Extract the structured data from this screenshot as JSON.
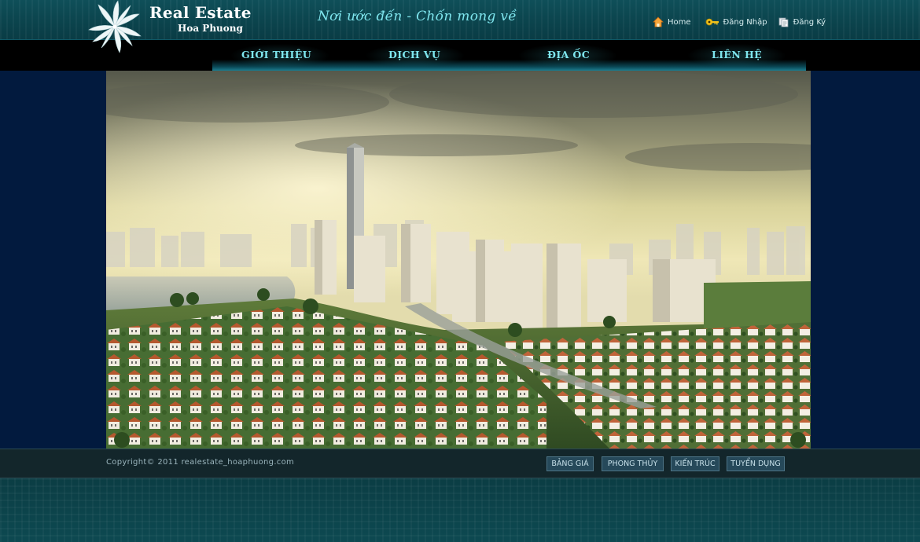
{
  "header": {
    "logo_title": "Real Estate",
    "logo_subtitle": "Hoa Phuong",
    "slogan": "Nơi ước đến - Chốn mong về",
    "links": [
      {
        "label": "Home",
        "icon": "home-icon"
      },
      {
        "label": "Đăng Nhập",
        "icon": "key-icon"
      },
      {
        "label": "Đăng Ký",
        "icon": "register-icon"
      }
    ]
  },
  "nav": {
    "items": [
      "GIỚI THIỆU",
      "DỊCH VỤ",
      "ĐỊA ỐC",
      "LIÊN HỆ"
    ]
  },
  "banner": {
    "image": "city-skyline-villas-banner"
  },
  "footer": {
    "copyright": "Copyright© 2011 realestate_hoaphuong.com",
    "links": [
      "BẢNG GIÁ",
      "PHONG THỦY",
      "KIẾN TRÚC",
      "TUYỂN DỤNG"
    ]
  },
  "colors": {
    "accent": "#7fe6ee",
    "header_bg": "#0b434c",
    "main_bg": "#021a3e",
    "footer_bg": "#13262b"
  }
}
